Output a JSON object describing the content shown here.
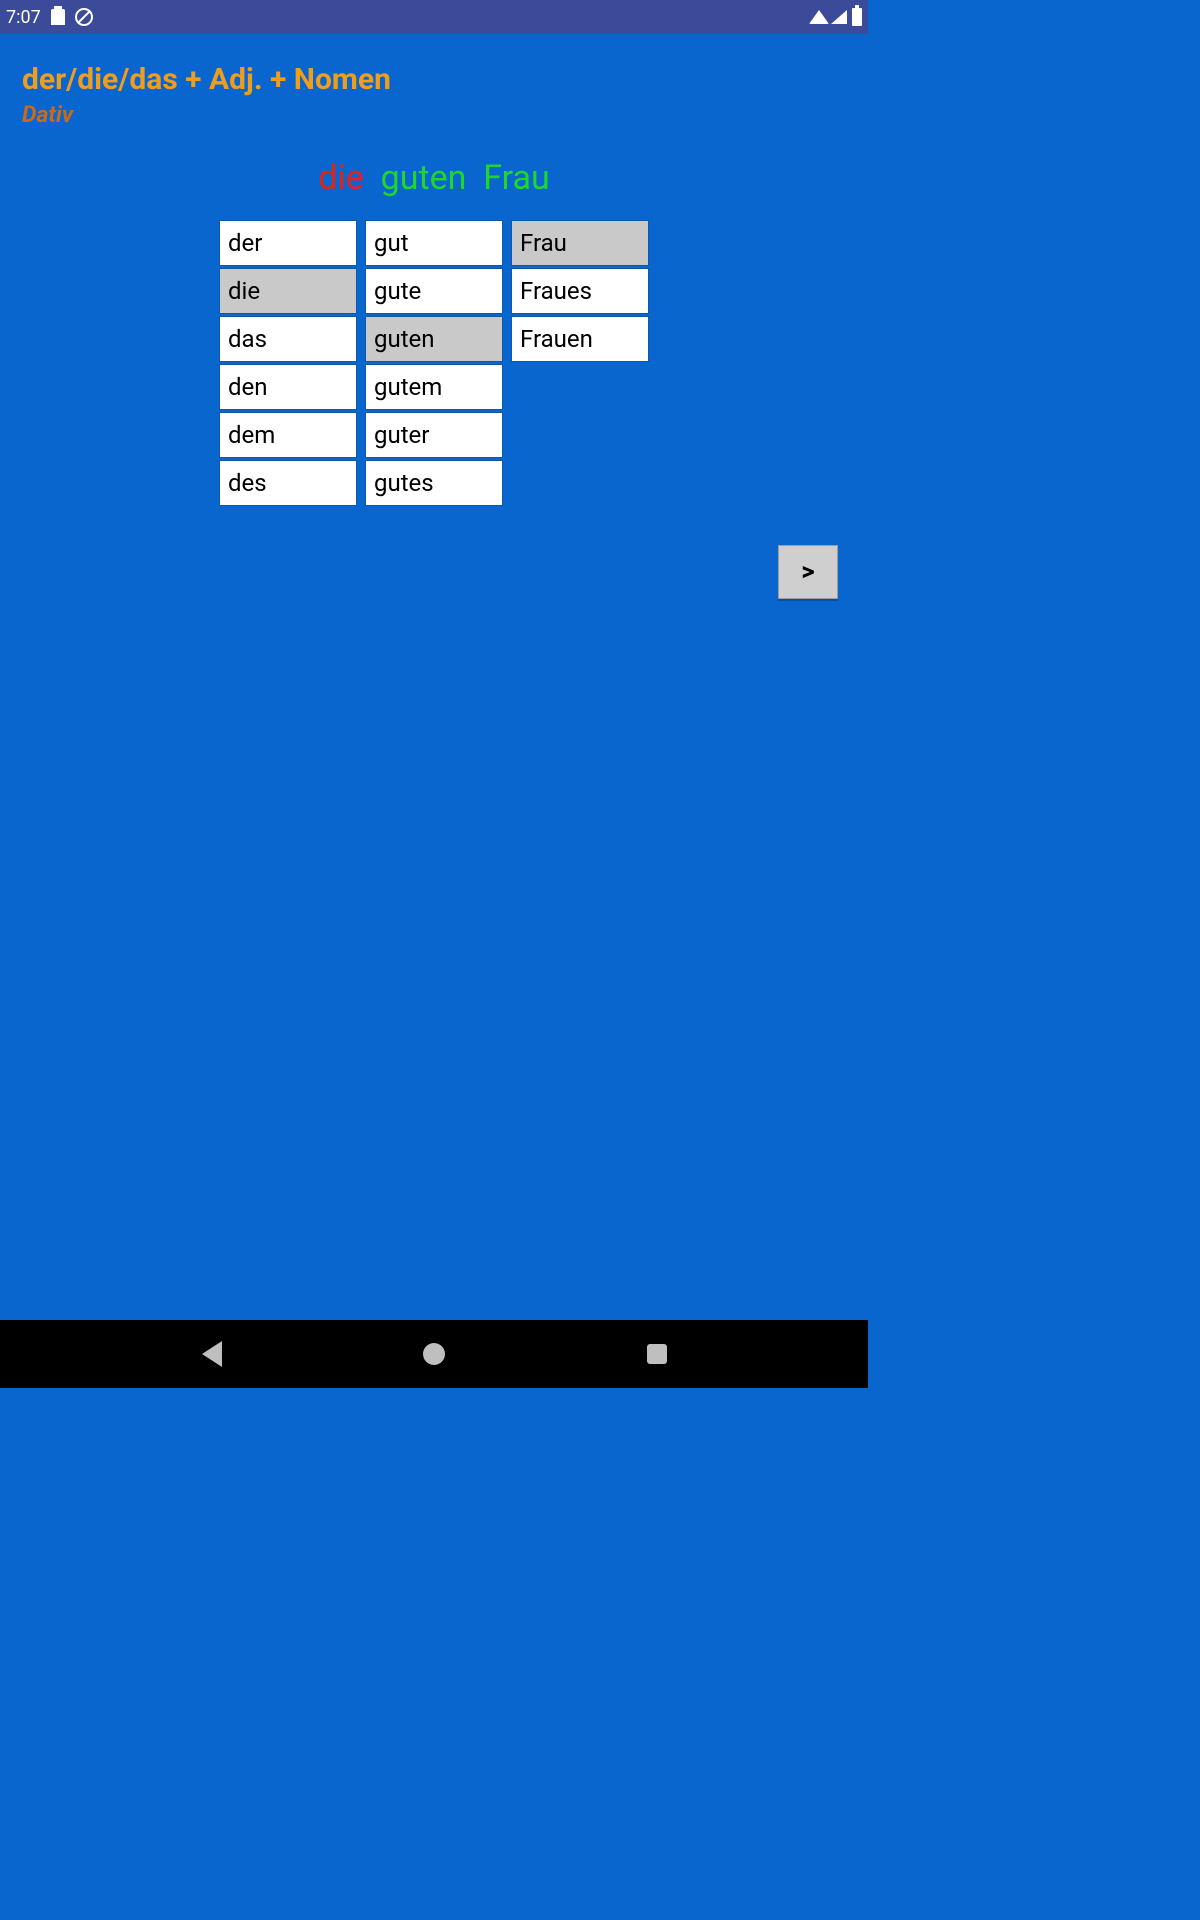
{
  "status": {
    "time": "7:07"
  },
  "header": {
    "title": "der/die/das + Adj. + Nomen",
    "subtitle": "Dativ"
  },
  "phrase": {
    "parts": [
      {
        "text": "die",
        "state": "wrong"
      },
      {
        "text": "guten",
        "state": "ok"
      },
      {
        "text": "Frau",
        "state": "ok"
      }
    ]
  },
  "columns": [
    {
      "name": "article",
      "options": [
        "der",
        "die",
        "das",
        "den",
        "dem",
        "des"
      ],
      "selected": "die"
    },
    {
      "name": "adjective",
      "options": [
        "gut",
        "gute",
        "guten",
        "gutem",
        "guter",
        "gutes"
      ],
      "selected": "guten"
    },
    {
      "name": "noun",
      "options": [
        "Frau",
        "Fraues",
        "Frauen"
      ],
      "selected": "Frau"
    }
  ],
  "next_button": ">"
}
